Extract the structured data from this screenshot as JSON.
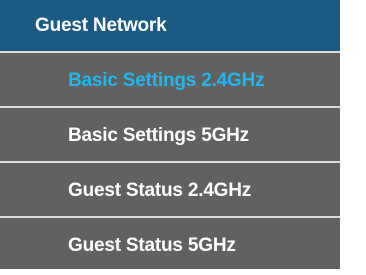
{
  "menu": {
    "header": "Guest Network",
    "items": [
      {
        "label": "Basic Settings 2.4GHz",
        "active": true
      },
      {
        "label": "Basic Settings 5GHz",
        "active": false
      },
      {
        "label": "Guest Status 2.4GHz",
        "active": false
      },
      {
        "label": "Guest Status 5GHz",
        "active": false
      }
    ]
  },
  "colors": {
    "header_bg": "#1a5a85",
    "item_bg": "#616161",
    "item_text": "#ffffff",
    "active_text": "#1eb7ee",
    "separator": "#dcdcdc"
  }
}
